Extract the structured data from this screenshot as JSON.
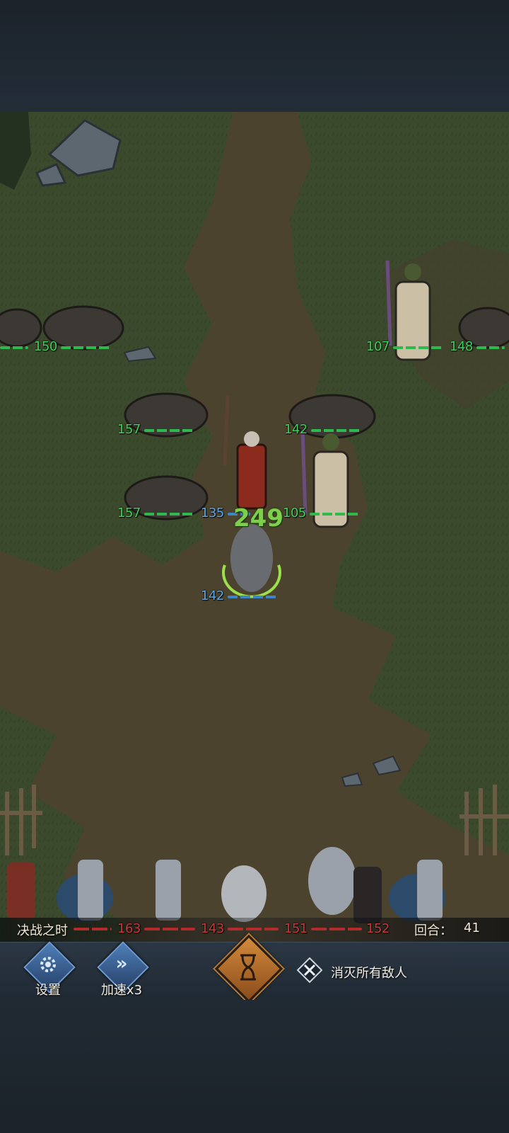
{
  "battle": {
    "phase_label": "决战之时",
    "round_label": "回合：",
    "round_value": "41",
    "damage_popup": "249",
    "objective": "消灭所有敌人"
  },
  "controls": {
    "settings_label": "设置",
    "speed_label": "加速x3",
    "speed_glyph": "»"
  },
  "enemy_hp": [
    "150",
    "107",
    "148",
    "157",
    "142",
    "157",
    "105"
  ],
  "ally_hp": [
    "135",
    "142"
  ],
  "front_row_hp": [
    "163",
    "143",
    "151",
    "152"
  ],
  "colors": {
    "enemy_hp": "#3fcf5c",
    "ally_hp": "#5aa8e6",
    "front_row_hp": "#c53a3a",
    "damage": "#7ed04b",
    "button_accent": "#4e7fb8",
    "hourglass_accent": "#d28a3a"
  },
  "icons": {
    "settings": "gear-icon",
    "speed": "fast-forward-icon",
    "end_turn": "hourglass-icon",
    "objective": "crossed-swords-icon"
  }
}
